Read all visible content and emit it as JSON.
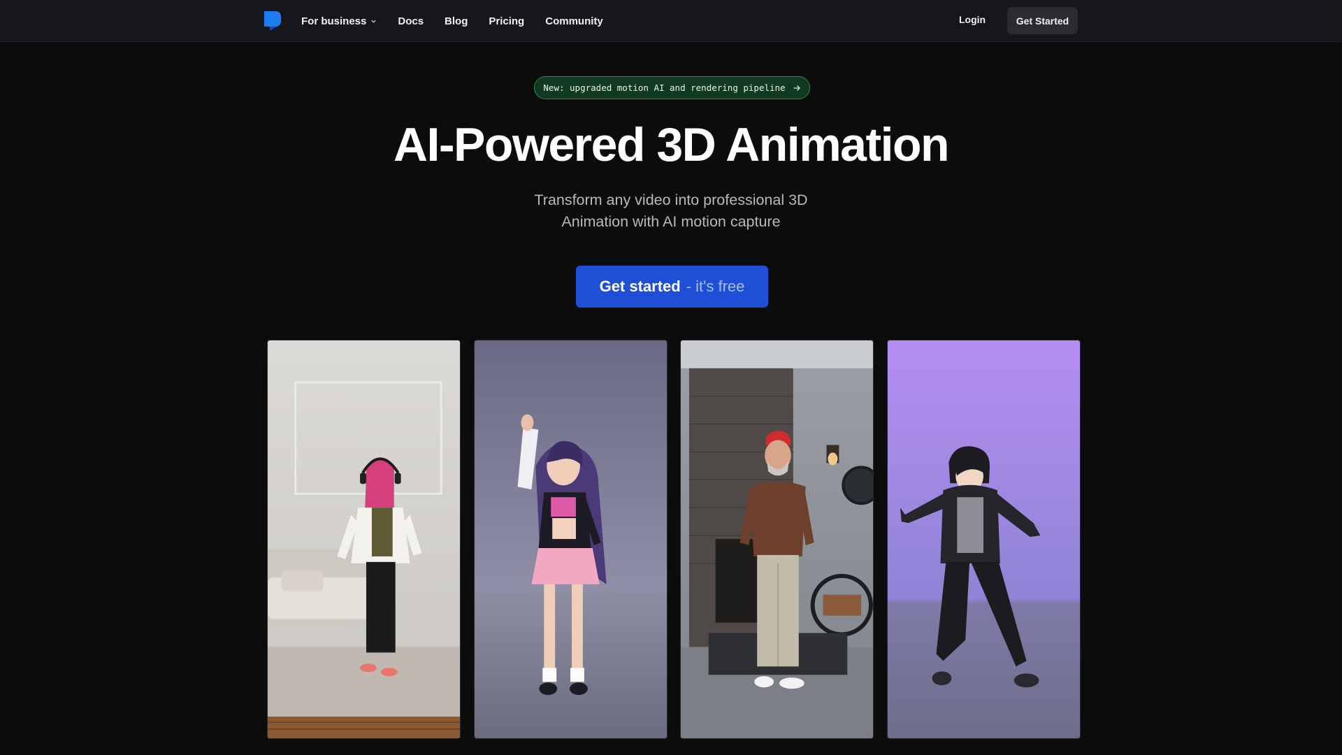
{
  "nav": {
    "logo_icon": "brand-logo-icon",
    "items": [
      {
        "label": "For business",
        "has_dropdown": true
      },
      {
        "label": "Docs"
      },
      {
        "label": "Blog"
      },
      {
        "label": "Pricing"
      },
      {
        "label": "Community"
      }
    ],
    "login_label": "Login",
    "cta_label": "Get Started"
  },
  "announcement": {
    "text": "New: upgraded motion AI and rendering pipeline",
    "icon": "arrow-right-icon"
  },
  "hero": {
    "title": "AI-Powered 3D Animation",
    "subtitle_line1": "Transform any video into professional 3D",
    "subtitle_line2": "Animation with AI motion capture",
    "cta_strong": "Get started",
    "cta_light": "- it's free"
  },
  "gallery": {
    "items": [
      {
        "kind": "video",
        "subject": "woman with pink hair and headphones dancing in living room"
      },
      {
        "kind": "3d-avatar",
        "subject": "anime girl character with purple hair in pink skirt"
      },
      {
        "kind": "video",
        "subject": "older man in red beanie dancing near brick fireplace"
      },
      {
        "kind": "3d-avatar",
        "subject": "anime character in black and grey jacket on purple background"
      }
    ]
  },
  "colors": {
    "background": "#0c0c0d",
    "navbar": "#16171a",
    "accent_blue": "#1f4fd6",
    "announce_green": "#2a8a4c",
    "logo_blue": "#1e7cf2"
  }
}
